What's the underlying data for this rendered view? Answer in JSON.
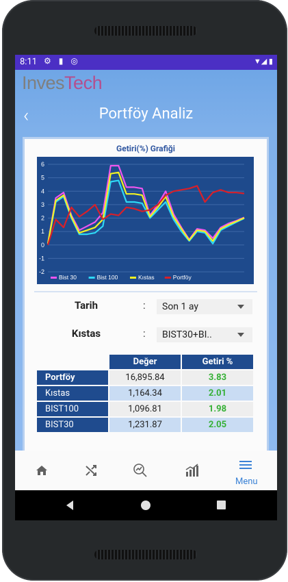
{
  "status_bar": {
    "time": "8:11"
  },
  "app": {
    "logo_part1": "Inves",
    "logo_part2": "Tech",
    "page_title": "Portföy Analiz",
    "back_glyph": "‹"
  },
  "chart_card": {
    "title": "Getiri(%) Grafiği"
  },
  "chart_data": {
    "type": "line",
    "title": "Getiri(%) Grafiği",
    "ylim": [
      -2,
      6
    ],
    "yticks": [
      -2,
      -1,
      0,
      1,
      2,
      3,
      4,
      5,
      6
    ],
    "grid": true,
    "legend_position": "bottom-left",
    "x": [
      0,
      1,
      2,
      3,
      4,
      5,
      6,
      7,
      8,
      9,
      10,
      11,
      12,
      13,
      14,
      15,
      16,
      17,
      18,
      19,
      20,
      21,
      22,
      23,
      24,
      25
    ],
    "series": [
      {
        "name": "Bist 30",
        "color": "#ee55ee",
        "values": [
          0.1,
          3.5,
          3.9,
          2.2,
          1.1,
          1.4,
          1.7,
          2.4,
          5.9,
          5.9,
          4.3,
          4.3,
          4.2,
          2.2,
          3.0,
          4.0,
          2.3,
          1.3,
          0.4,
          1.2,
          1.1,
          0.5,
          1.3,
          1.6,
          1.8,
          2.05
        ]
      },
      {
        "name": "Bist 100",
        "color": "#2ed8f5",
        "values": [
          0.1,
          3.2,
          3.6,
          2.0,
          0.8,
          0.8,
          0.9,
          1.4,
          4.7,
          4.8,
          3.2,
          3.2,
          3.1,
          2.0,
          2.6,
          3.2,
          1.9,
          1.0,
          0.3,
          1.0,
          0.9,
          0.1,
          1.1,
          1.4,
          1.7,
          1.98
        ]
      },
      {
        "name": "Kıstas",
        "color": "#f2f222",
        "values": [
          0.1,
          3.3,
          3.7,
          2.1,
          0.9,
          1.1,
          1.3,
          1.9,
          5.3,
          5.4,
          3.8,
          3.8,
          3.7,
          2.1,
          2.8,
          3.6,
          2.1,
          1.2,
          0.35,
          1.1,
          1.0,
          0.3,
          1.2,
          1.5,
          1.75,
          2.01
        ]
      },
      {
        "name": "Portföy",
        "color": "#d8202a",
        "values": [
          0.0,
          1.9,
          1.3,
          2.8,
          2.1,
          2.5,
          3.0,
          1.9,
          2.3,
          2.2,
          2.8,
          2.7,
          2.5,
          2.6,
          3.0,
          3.7,
          4.0,
          4.1,
          4.2,
          4.4,
          3.2,
          3.9,
          4.1,
          3.9,
          3.9,
          3.83
        ]
      }
    ]
  },
  "filters": {
    "date": {
      "label": "Tarih",
      "colon": ":",
      "value": "Son 1 ay"
    },
    "benchmark": {
      "label": "Kıstas",
      "colon": ":",
      "value": "BIST30+BI.."
    }
  },
  "table": {
    "headers": [
      "Değer",
      "Getiri %"
    ],
    "rows": [
      {
        "name": "Portföy",
        "value": "16,895.84",
        "return": "3.83"
      },
      {
        "name": "Kıstas",
        "value": "1,164.34",
        "return": "2.01"
      },
      {
        "name": "BIST100",
        "value": "1,096.81",
        "return": "1.98"
      },
      {
        "name": "BIST30",
        "value": "1,231.87",
        "return": "2.05"
      }
    ]
  },
  "bottom_nav": {
    "items": [
      {
        "icon": "home-icon"
      },
      {
        "icon": "shuffle-icon"
      },
      {
        "icon": "search-icon"
      },
      {
        "icon": "chart-icon"
      },
      {
        "icon": "menu-icon",
        "label": "Menu",
        "active": true
      }
    ],
    "accent": "#3b82d6"
  }
}
